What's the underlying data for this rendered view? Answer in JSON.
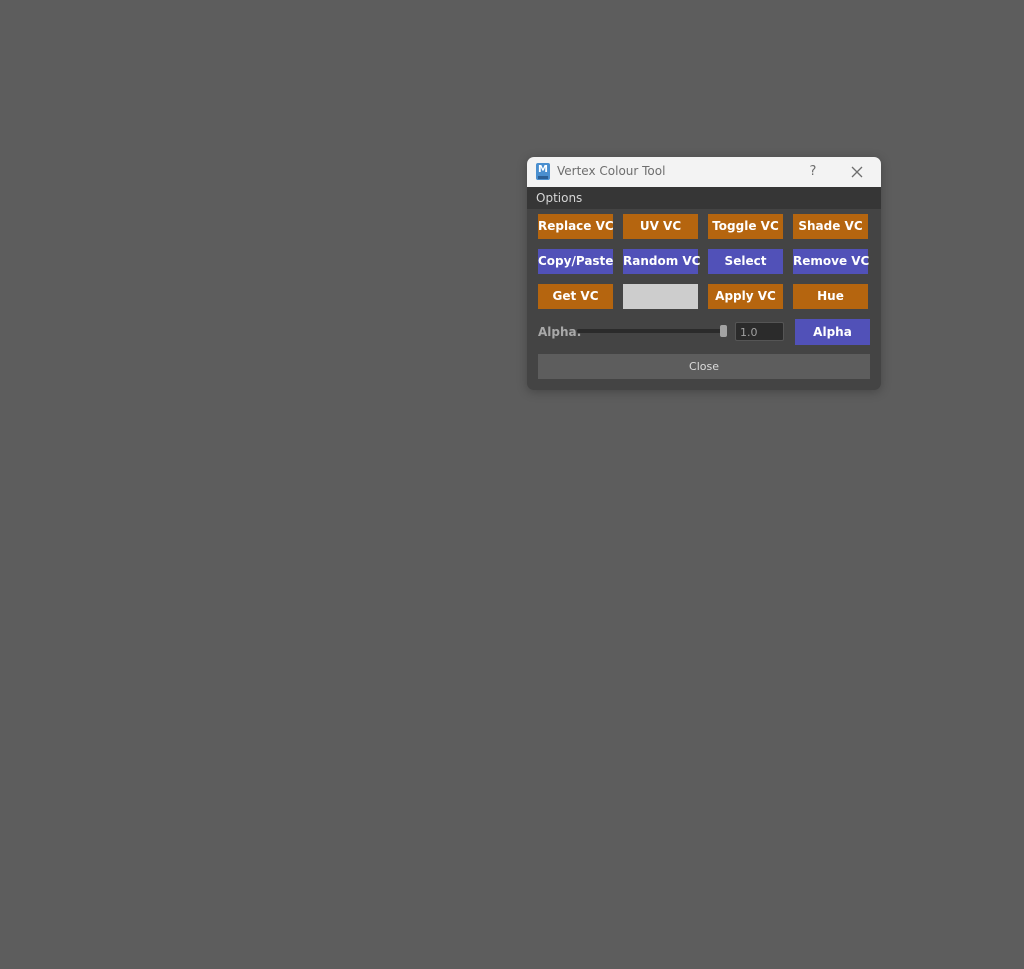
{
  "window": {
    "title": "Vertex Colour Tool",
    "help_label": "?",
    "app_icon": {
      "letter": "M",
      "name": "maya-icon"
    }
  },
  "menu": {
    "options_label": "Options"
  },
  "buttons": {
    "row1": [
      "Replace VC",
      "UV VC",
      "Toggle VC",
      "Shade VC"
    ],
    "row2": [
      "Copy/Paste",
      "Random VC",
      "Select",
      "Remove VC"
    ],
    "row3": [
      "Get VC",
      "Apply VC",
      "Hue"
    ]
  },
  "colors": {
    "orange": "#b5650f",
    "blue": "#5151b8",
    "swatch": "#cdcdcd",
    "background": "#5d5d5d"
  },
  "alpha": {
    "label": "Alpha:",
    "value": "1.0",
    "slider_value": 1.0,
    "button_label": "Alpha"
  },
  "footer": {
    "close_label": "Close"
  }
}
